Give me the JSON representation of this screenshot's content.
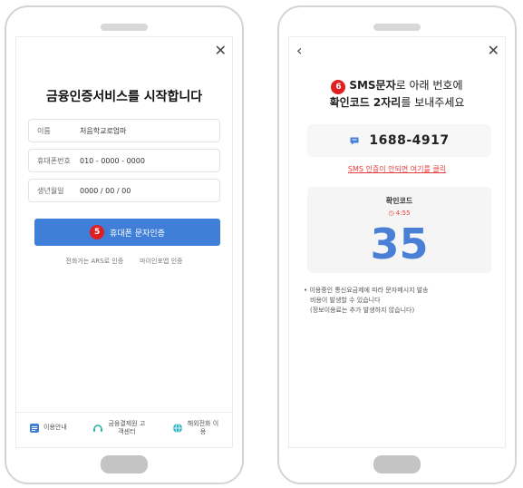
{
  "left_screen": {
    "title": "금융인증서비스를 시작합니다",
    "fields": [
      {
        "label": "이름",
        "value": "처음학교로엄마"
      },
      {
        "label": "휴대폰번호",
        "value": "010 - 0000 - 0000"
      },
      {
        "label": "생년월일",
        "value": "0000 / 00 / 00"
      }
    ],
    "step_badge": "5",
    "primary_button": "휴대폰 문자인증",
    "alt_links": [
      "전화거는 ARS로 인증",
      "마이인포앱 인증"
    ],
    "footer": [
      {
        "icon": "document-icon",
        "label": "이용안내"
      },
      {
        "icon": "headset-icon",
        "label": "금융결제원 고객센터"
      },
      {
        "icon": "globe-icon",
        "label": "해외전화 이용"
      }
    ]
  },
  "right_screen": {
    "step_badge": "6",
    "heading_bold": "SMS문자",
    "heading_rest": "로 아래 번호에",
    "heading2_bold": "확인코드 2자리",
    "heading2_rest": "를 보내주세요",
    "phone_number": "1688-4917",
    "retry_link": "SMS 인증이 안되면 여기를 클릭",
    "code_label": "확인코드",
    "timer": "4:55",
    "code_value": "35",
    "notice_lines": [
      "이용중인 통신요금제에 따라 문자메시지 발송",
      "비용이 발생할 수 있습니다",
      "(정보이용료는 추가 발생하지 않습니다)"
    ]
  },
  "colors": {
    "primary_blue": "#3f7fd8",
    "code_blue": "#4a7fd6",
    "alert_red": "#e63b3b",
    "badge_red": "#e02020"
  }
}
